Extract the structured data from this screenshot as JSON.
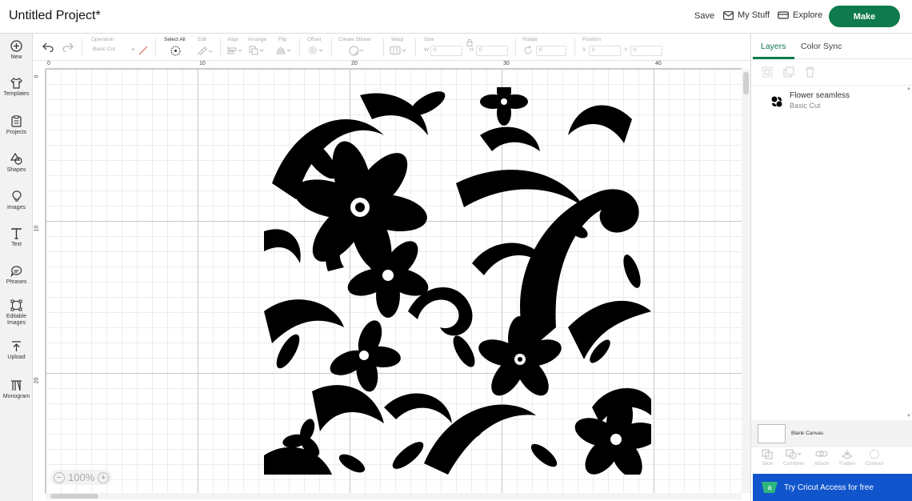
{
  "header": {
    "title": "Untitled Project*",
    "save_label": "Save",
    "my_stuff_label": "My Stuff",
    "explore_label": "Explore",
    "make_label": "Make"
  },
  "sidebar": {
    "items": [
      {
        "label": "New",
        "icon": "plus-circle-icon"
      },
      {
        "label": "Templates",
        "icon": "shirt-icon"
      },
      {
        "label": "Projects",
        "icon": "clipboard-icon"
      },
      {
        "label": "Shapes",
        "icon": "shapes-icon"
      },
      {
        "label": "Images",
        "icon": "lightbulb-icon"
      },
      {
        "label": "Text",
        "icon": "text-icon"
      },
      {
        "label": "Phrases",
        "icon": "speech-bubble-icon"
      },
      {
        "label": "Editable Images",
        "icon": "editable-image-icon"
      },
      {
        "label": "Upload",
        "icon": "upload-icon"
      },
      {
        "label": "Monogram",
        "icon": "monogram-icon"
      }
    ]
  },
  "toolbar": {
    "operation_label": "Operation",
    "operation_value": "Basic Cut",
    "select_all_label": "Select All",
    "edit_label": "Edit",
    "align_label": "Align",
    "arrange_label": "Arrange",
    "flip_label": "Flip",
    "offset_label": "Offset",
    "create_sticker_label": "Create Sticker",
    "warp_label": "Warp",
    "size_label": "Size",
    "size_w_label": "W",
    "size_h_label": "H",
    "size_w_value": "0",
    "size_h_value": "0",
    "rotate_label": "Rotate",
    "rotate_value": "0",
    "position_label": "Position",
    "pos_x_label": "X",
    "pos_y_label": "Y",
    "pos_x_value": "0",
    "pos_y_value": "0"
  },
  "canvas": {
    "ruler_top": [
      "0",
      "10",
      "20",
      "30",
      "40"
    ],
    "ruler_left": [
      "0",
      "10",
      "20"
    ],
    "zoom_value": "100%",
    "zoom_minus": "−",
    "zoom_plus": "+"
  },
  "right_panel": {
    "tabs": [
      "Layers",
      "Color Sync"
    ],
    "layer": {
      "name": "Flower seamless",
      "operation": "Basic Cut"
    },
    "blank_canvas_label": "Blank Canvas",
    "bottom_tools": [
      "Slice",
      "Combine",
      "Attach",
      "Flatten",
      "Contour"
    ],
    "access_label": "Try Cricut Access for free"
  },
  "colors": {
    "accent": "#0f7a4d",
    "access_banner": "#1155cc"
  }
}
